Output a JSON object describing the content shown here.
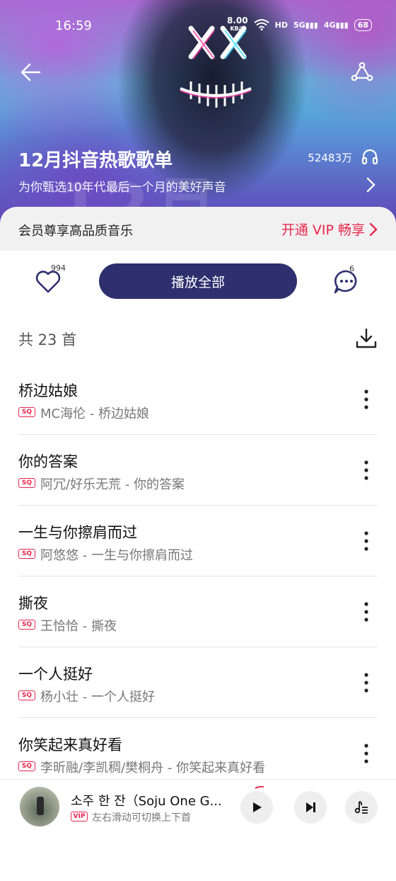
{
  "status_bar": {
    "time": "16:59",
    "net_speed_value": "8.00",
    "net_speed_unit": "KB/S",
    "hd_label": "HD",
    "sig1": "5G",
    "sig2": "4G",
    "battery": "68"
  },
  "header": {
    "title": "12月抖音热歌歌单",
    "listen_count": "52483万",
    "description": "为你甄选10年代最后一个月的美好声音",
    "bg_text": "12月"
  },
  "vip_bar": {
    "text": "会员尊享高品质音乐",
    "cta": "开通 VIP 畅享"
  },
  "actions": {
    "like_count": "994",
    "play_all_label": "播放全部",
    "comment_count": "6"
  },
  "list": {
    "count_label": "共 23 首",
    "quality_badge": "SQ",
    "songs": [
      {
        "title": "桥边姑娘",
        "artist": "MC海伦 - 桥边姑娘"
      },
      {
        "title": "你的答案",
        "artist": "阿冗/好乐无荒 - 你的答案"
      },
      {
        "title": "一生与你擦肩而过",
        "artist": "阿悠悠 - 一生与你擦肩而过"
      },
      {
        "title": "撕夜",
        "artist": "王恰恰 - 撕夜"
      },
      {
        "title": "一个人挺好",
        "artist": "杨小壮 - 一个人挺好"
      },
      {
        "title": "你笑起来真好看",
        "artist": "李昕融/李凯稠/樊桐舟 - 你笑起来真好看"
      }
    ]
  },
  "mini_player": {
    "title": "소주 한 잔（Soju One G...",
    "vip_badge": "VIP",
    "hint": "左右滑动可切换上下首"
  },
  "colors": {
    "accent_red": "#e8274d",
    "play_all_bg": "#2d2f6e"
  },
  "icons": [
    "back-arrow-icon",
    "share-icon",
    "headphone-icon",
    "chevron-right-icon",
    "heart-icon",
    "comment-icon",
    "download-icon",
    "more-vertical-icon",
    "play-icon",
    "next-icon",
    "playlist-queue-icon"
  ]
}
